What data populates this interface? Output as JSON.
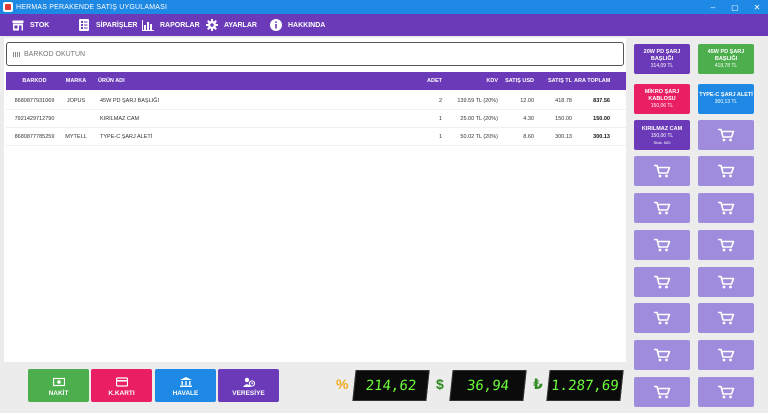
{
  "window": {
    "title": "HERMAS PERAKENDE SATIŞ UYGULAMASI",
    "minimize": "–",
    "maximize": "▢",
    "close": "✕"
  },
  "menu": [
    {
      "label": "STOK",
      "icon": "store-icon"
    },
    {
      "label": "SİPARİŞLER",
      "icon": "orders-icon"
    },
    {
      "label": "RAPORLAR",
      "icon": "bar-chart-icon"
    },
    {
      "label": "AYARLAR",
      "icon": "gear-icon"
    },
    {
      "label": "HAKKINDA",
      "icon": "info-icon"
    }
  ],
  "barcode": {
    "placeholder": "BARKOD OKUTUN"
  },
  "table": {
    "headers": [
      "BARKOD",
      "MARKA",
      "ÜRÜN ADI",
      "ADET",
      "KDV",
      "SATIŞ USD",
      "SATIŞ TL",
      "ARA TOPLAM"
    ],
    "rows": [
      [
        "8680877931069",
        "JOPUS",
        "45W PD ŞARJ BAŞLIĞI",
        "2",
        "139.59 TL (20%)",
        "12.00",
        "418.78",
        "837.56"
      ],
      [
        "7921429712790",
        "",
        "KIRILMAZ CAM",
        "1",
        "25.00 TL (20%)",
        "4.30",
        "150.00",
        "150.00"
      ],
      [
        "8680877785259",
        "MYTELL",
        "TYPE-C ŞARJ ALETİ",
        "1",
        "50.02 TL (20%)",
        "8.60",
        "300.13",
        "300.13"
      ]
    ]
  },
  "products": [
    {
      "name": "20W PD ŞARJ BAŞLIĞI",
      "price": "314,09 TL",
      "stock": "",
      "color": "#6a3ab8"
    },
    {
      "name": "45W PD ŞARJ BAŞLIĞI",
      "price": "418,78 TL",
      "stock": "",
      "color": "#4cae4c"
    },
    {
      "name": "MİKRO ŞARJ KABLOSU",
      "price": "150,06 TL",
      "stock": "",
      "color": "#e91e63"
    },
    {
      "name": "TYPE-C ŞARJ ALETİ",
      "price": "300,13 TL",
      "stock": "",
      "color": "#1e88e5"
    },
    {
      "name": "KIRILMAZ CAM",
      "price": "150,00 TL",
      "stock": "Stok: 500",
      "color": "#6a3ab8"
    }
  ],
  "payments": [
    {
      "label": "NAKİT",
      "icon": "cash-icon",
      "color": "#4cae4c"
    },
    {
      "label": "K.KARTI",
      "icon": "credit-card-icon",
      "color": "#e91e63"
    },
    {
      "label": "HAVALE",
      "icon": "bank-icon",
      "color": "#1e88e5"
    },
    {
      "label": "VERESİYE",
      "icon": "clock-user-icon",
      "color": "#6a3ab8"
    }
  ],
  "totals": {
    "kdv_symbol": "%",
    "kdv": "214,62",
    "usd_symbol": "$",
    "usd": "36,94",
    "tl_symbol": "₺",
    "tl": "1.287,69"
  }
}
